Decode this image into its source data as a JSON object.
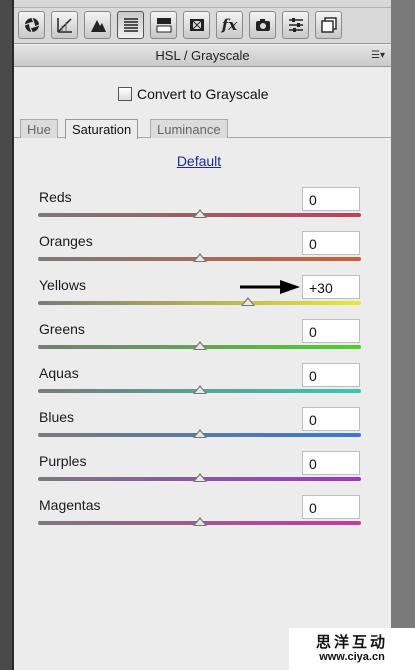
{
  "toolbar": {
    "icons": [
      "basic-icon",
      "tone-curve-icon",
      "detail-icon",
      "hsl-icon",
      "split-toning-icon",
      "lens-corrections-icon",
      "effects-icon",
      "camera-calibration-icon",
      "presets-icon",
      "snapshots-icon"
    ],
    "active_icon": "hsl-icon"
  },
  "header": {
    "title": "HSL / Grayscale"
  },
  "convert": {
    "label": "Convert to Grayscale",
    "checked": false
  },
  "tabs": [
    {
      "label": "Hue",
      "active": false
    },
    {
      "label": "Saturation",
      "active": true
    },
    {
      "label": "Luminance",
      "active": false
    }
  ],
  "default_label": "Default",
  "sliders": [
    {
      "label": "Reds",
      "value": "0",
      "level": 0,
      "colors": [
        "#7a7a7a",
        "#c0405a"
      ]
    },
    {
      "label": "Oranges",
      "value": "0",
      "level": 0,
      "colors": [
        "#7a7a7a",
        "#c8603c"
      ]
    },
    {
      "label": "Yellows",
      "value": "+30",
      "level": 30,
      "colors": [
        "#7a7a7a",
        "#e8e838"
      ]
    },
    {
      "label": "Greens",
      "value": "0",
      "level": 0,
      "colors": [
        "#7a7a7a",
        "#4ed02c"
      ]
    },
    {
      "label": "Aquas",
      "value": "0",
      "level": 0,
      "colors": [
        "#7a7a7a",
        "#38c8b0"
      ]
    },
    {
      "label": "Blues",
      "value": "0",
      "level": 0,
      "colors": [
        "#7a7a7a",
        "#3878d0"
      ]
    },
    {
      "label": "Purples",
      "value": "0",
      "level": 0,
      "colors": [
        "#7a7a7a",
        "#9838c8"
      ]
    },
    {
      "label": "Magentas",
      "value": "0",
      "level": 0,
      "colors": [
        "#7a7a7a",
        "#c838a0"
      ]
    }
  ],
  "watermark": {
    "brand": "思洋互动",
    "url": "www.ciya.cn"
  }
}
